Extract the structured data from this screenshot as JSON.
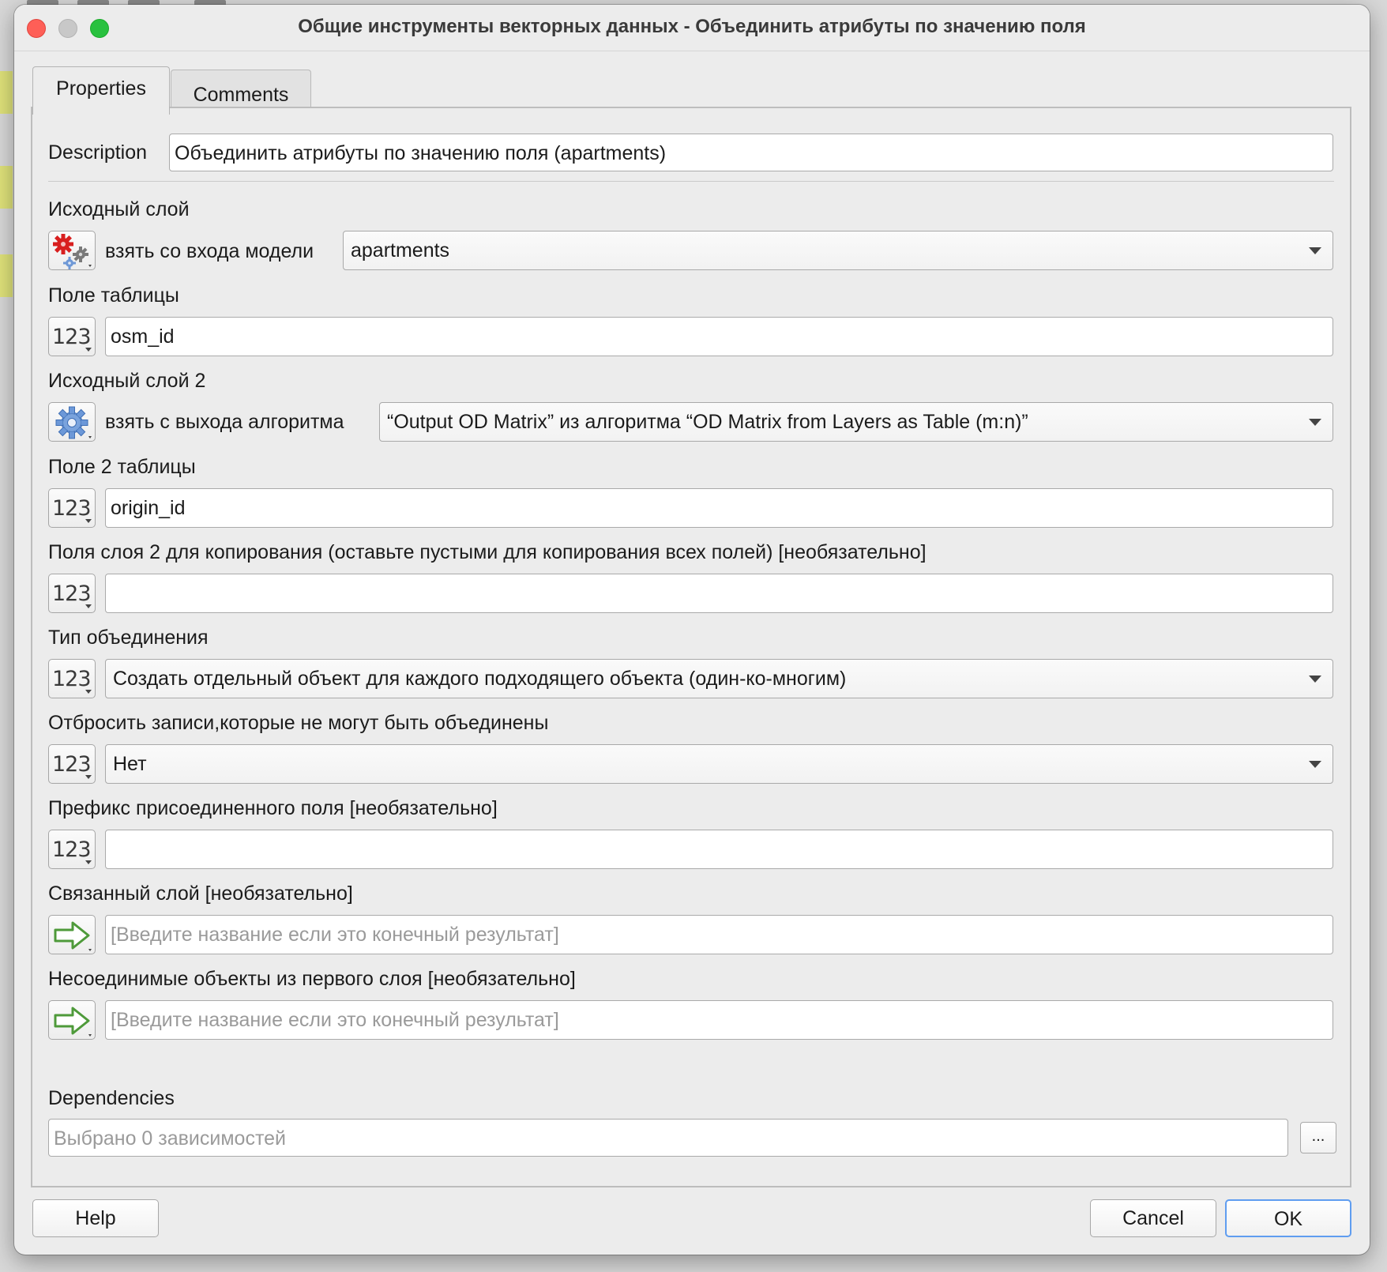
{
  "window": {
    "title": "Общие инструменты векторных данных - Объединить атрибуты по значению поля"
  },
  "tabs": [
    {
      "label": "Properties",
      "active": true
    },
    {
      "label": "Comments",
      "active": false
    }
  ],
  "description": {
    "label": "Description",
    "value": "Объединить атрибуты по значению поля (apartments)"
  },
  "params": {
    "input_layer": {
      "label": "Исходный слой",
      "source_label": "взять со входа модели",
      "value": "apartments",
      "icon": "model-input-gears-icon"
    },
    "table_field": {
      "label": "Поле таблицы",
      "icon_text": "123",
      "value": "osm_id"
    },
    "input_layer_2": {
      "label": "Исходный слой 2",
      "source_label": "взять с выхода алгоритма",
      "value": "“Output OD Matrix” из алгоритма “OD Matrix from Layers as Table (m:n)”",
      "icon": "algorithm-output-gear-icon"
    },
    "table_field_2": {
      "label": "Поле 2 таблицы",
      "icon_text": "123",
      "value": "origin_id"
    },
    "fields_to_copy": {
      "label": "Поля слоя 2 для копирования (оставьте пустыми для копирования всех полей) [необязательно]",
      "icon_text": "123",
      "value": ""
    },
    "join_type": {
      "label": "Тип объединения",
      "icon_text": "123",
      "value": "Создать отдельный объект для каждого подходящего объекта (один-ко-многим)"
    },
    "discard_nonmatching": {
      "label": "Отбросить записи,которые не могут быть объединены",
      "icon_text": "123",
      "value": "Нет"
    },
    "prefix": {
      "label": "Префикс присоединенного поля [необязательно]",
      "icon_text": "123",
      "value": ""
    },
    "joined_layer": {
      "label": "Связанный слой [необязательно]",
      "placeholder": "[Введите название если это конечный результат]",
      "icon": "green-arrow-icon"
    },
    "unjoinable": {
      "label": "Несоединимые объекты из первого слоя [необязательно]",
      "placeholder": "[Введите название если это конечный результат]",
      "icon": "green-arrow-icon"
    }
  },
  "dependencies": {
    "label": "Dependencies",
    "placeholder": "Выбрано 0 зависимостей",
    "browse_label": "..."
  },
  "buttons": {
    "help": "Help",
    "cancel": "Cancel",
    "ok": "OK"
  },
  "colors": {
    "window_bg": "#ececec",
    "ok_focus_ring": "#5f9df0",
    "close_light": "#fe5f57",
    "zoom_light": "#29c13f",
    "arrow_green": "#4e9a3a"
  }
}
